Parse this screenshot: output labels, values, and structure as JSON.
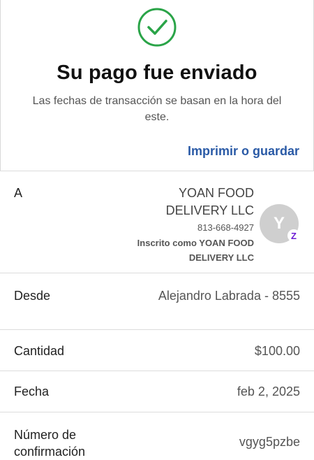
{
  "header": {
    "icon": "check-circle-icon",
    "title": "Su pago fue enviado",
    "subtitle": "Las fechas de transacción se basan en la hora del este.",
    "print_link": "Imprimir o guardar",
    "accent_color": "#2aa448",
    "link_color": "#2a5aa6"
  },
  "recipient": {
    "label": "A",
    "name": "YOAN FOOD DELIVERY LLC",
    "phone": "813-668-4927",
    "enrolled_as": "Inscrito como YOAN FOOD DELIVERY LLC",
    "avatar_letter": "Y",
    "badge_icon": "zelle-icon",
    "badge_text": "Z"
  },
  "details": {
    "from_label": "Desde",
    "from_value": "Alejandro Labrada - 8555",
    "amount_label": "Cantidad",
    "amount_value": "$100.00",
    "date_label": "Fecha",
    "date_value": "feb 2, 2025",
    "confirmation_label": "Número de confirmación",
    "confirmation_value": "vgyg5pzbe"
  }
}
